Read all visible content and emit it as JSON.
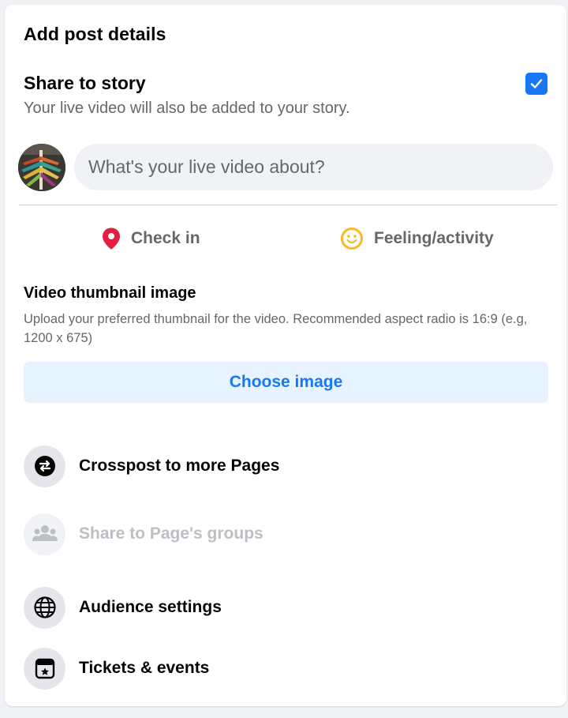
{
  "header": {
    "title": "Add post details"
  },
  "share_story": {
    "title": "Share to story",
    "description": "Your live video will also be added to your story.",
    "checked": true,
    "checkbox_color": "#1877f2"
  },
  "composer": {
    "placeholder": "What's your live video about?"
  },
  "actions": {
    "checkin": {
      "label": "Check in",
      "icon": "location-pin-icon",
      "color": "#e41e3f"
    },
    "feeling": {
      "label": "Feeling/activity",
      "icon": "smiley-face-icon",
      "color": "#f7b928"
    }
  },
  "thumbnail": {
    "title": "Video thumbnail image",
    "description": "Upload your preferred thumbnail for the video. Recommended aspect radio is 16:9 (e.g, 1200 x 675)",
    "button_label": "Choose image"
  },
  "options": [
    {
      "label": "Crosspost to more Pages",
      "icon": "crosspost-arrows-icon",
      "enabled": true
    },
    {
      "label": "Share to Page's groups",
      "icon": "groups-icon",
      "enabled": false
    },
    {
      "label": "Audience settings",
      "icon": "globe-icon",
      "enabled": true
    },
    {
      "label": "Tickets & events",
      "icon": "ticket-calendar-icon",
      "enabled": true
    }
  ],
  "colors": {
    "accent": "#1877f2",
    "secondary_text": "#65676b",
    "surface": "#f0f2f5"
  }
}
